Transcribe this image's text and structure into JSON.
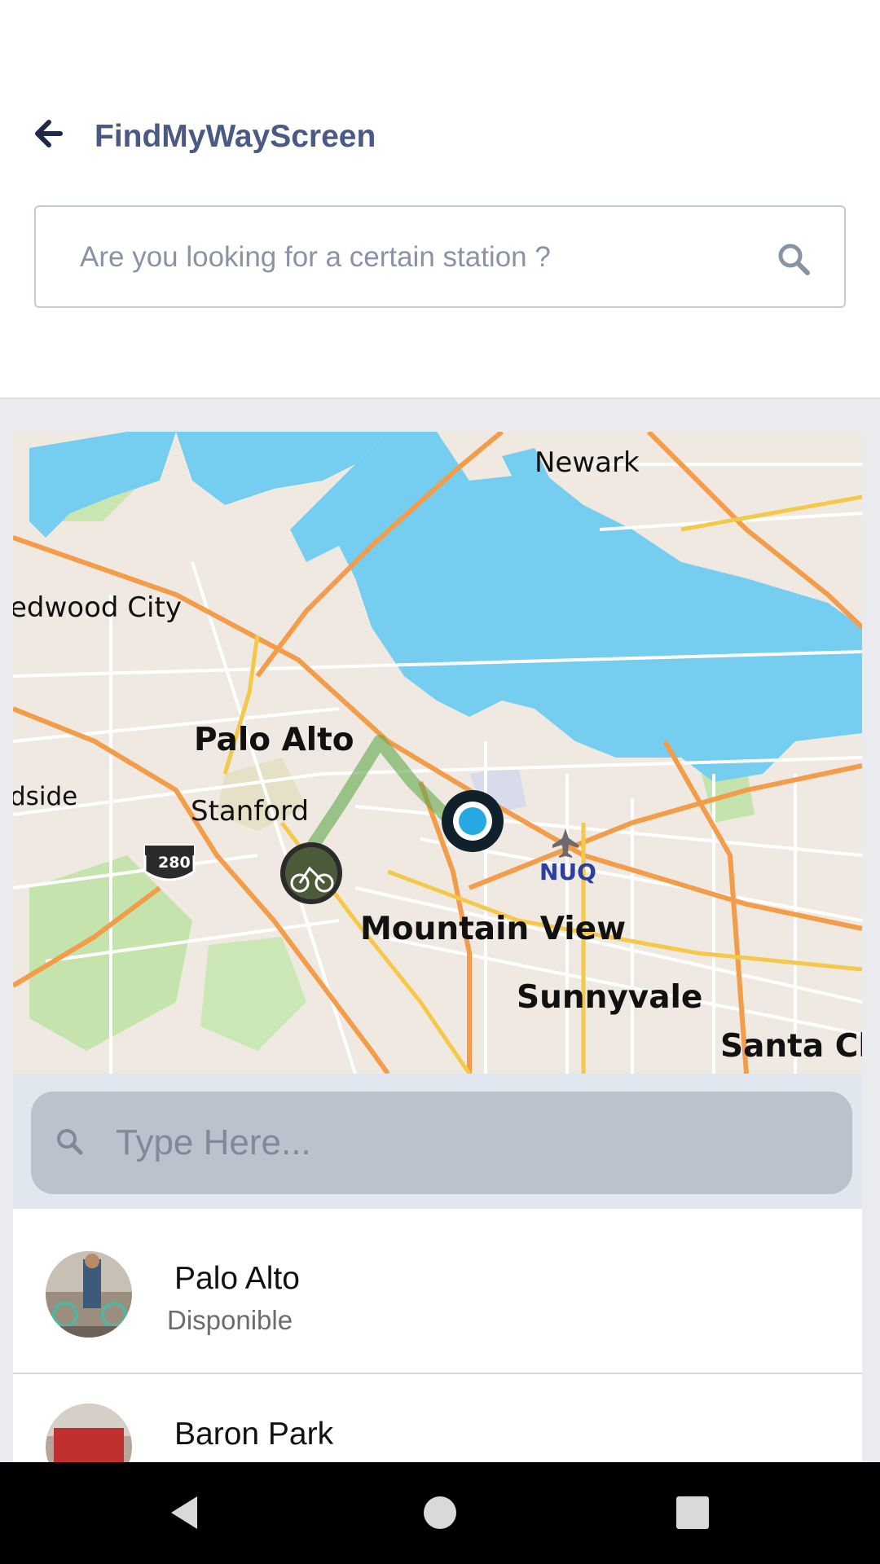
{
  "header": {
    "title": "FindMyWayScreen",
    "search_placeholder": "Are you looking for a certain station ?"
  },
  "map": {
    "labels": {
      "newark": "Newark",
      "redwood_city": "edwood City",
      "palo_alto": "Palo Alto",
      "woodside": "dside",
      "stanford": "Stanford",
      "highway": "280",
      "nuq": "NUQ",
      "mountain_view": "Mountain View",
      "sunnyvale": "Sunnyvale",
      "santa_clara": "Santa Cla"
    },
    "colors": {
      "land": "#efe9e1",
      "water": "#75cdef",
      "road_major": "#f39c4a",
      "road_minor": "#ffffff",
      "park": "#bfe2a0",
      "route": "#5fa84a",
      "marker": "#26a9e0"
    }
  },
  "filter": {
    "placeholder": "Type Here..."
  },
  "stations": [
    {
      "name": "Palo Alto",
      "status": "Disponible"
    },
    {
      "name": "Baron Park",
      "status": ""
    }
  ],
  "icons": {
    "back": "arrow-left-icon",
    "search": "search-icon",
    "filter_search": "magnifier-icon",
    "nav_back": "triangle-back-icon",
    "nav_home": "circle-home-icon",
    "nav_recent": "square-recent-icon"
  }
}
